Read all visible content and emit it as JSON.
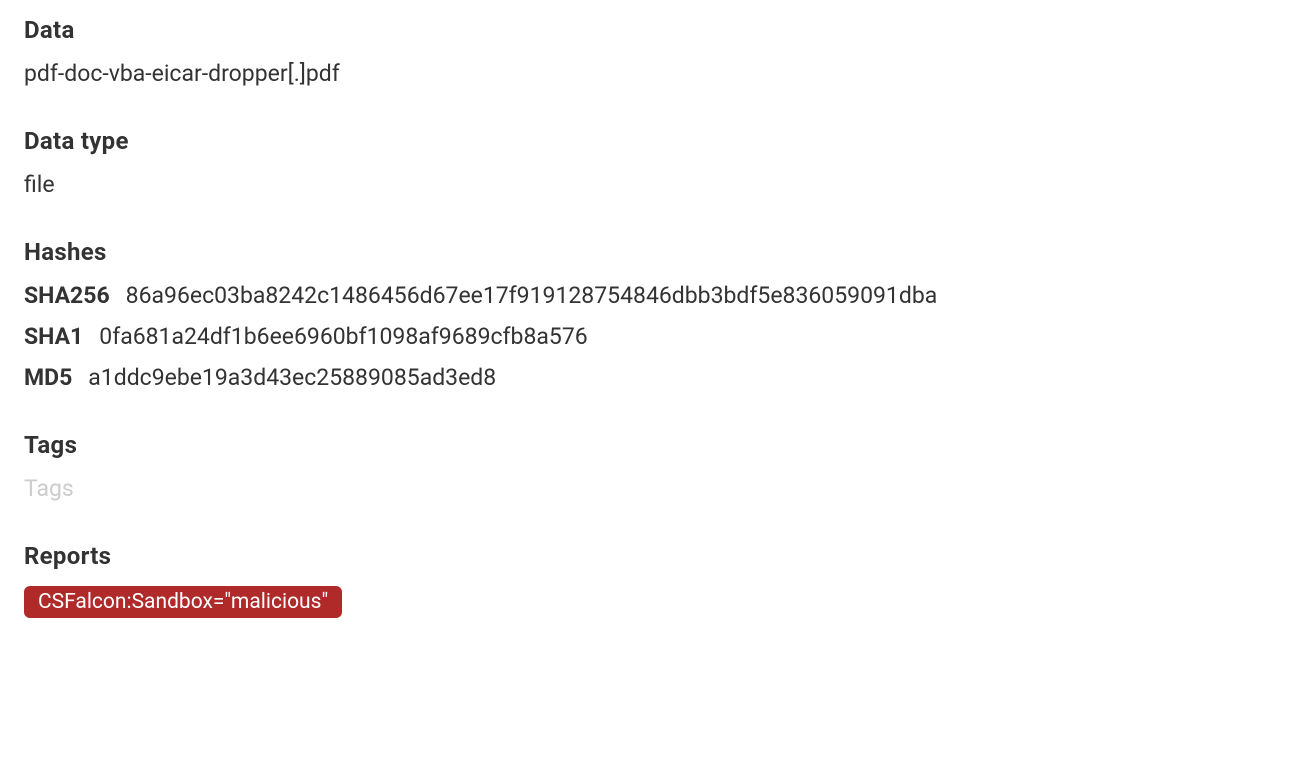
{
  "data_section": {
    "heading": "Data",
    "value": "pdf-doc-vba-eicar-dropper[.]pdf"
  },
  "data_type_section": {
    "heading": "Data type",
    "value": "file"
  },
  "hashes_section": {
    "heading": "Hashes",
    "rows": [
      {
        "label": "SHA256",
        "value": "86a96ec03ba8242c1486456d67ee17f919128754846dbb3bdf5e836059091dba"
      },
      {
        "label": "SHA1",
        "value": "0fa681a24df1b6ee6960bf1098af9689cfb8a576"
      },
      {
        "label": "MD5",
        "value": "a1ddc9ebe19a3d43ec25889085ad3ed8"
      }
    ]
  },
  "tags_section": {
    "heading": "Tags",
    "placeholder": "Tags"
  },
  "reports_section": {
    "heading": "Reports",
    "badges": [
      "CSFalcon:Sandbox=\"malicious\""
    ]
  }
}
